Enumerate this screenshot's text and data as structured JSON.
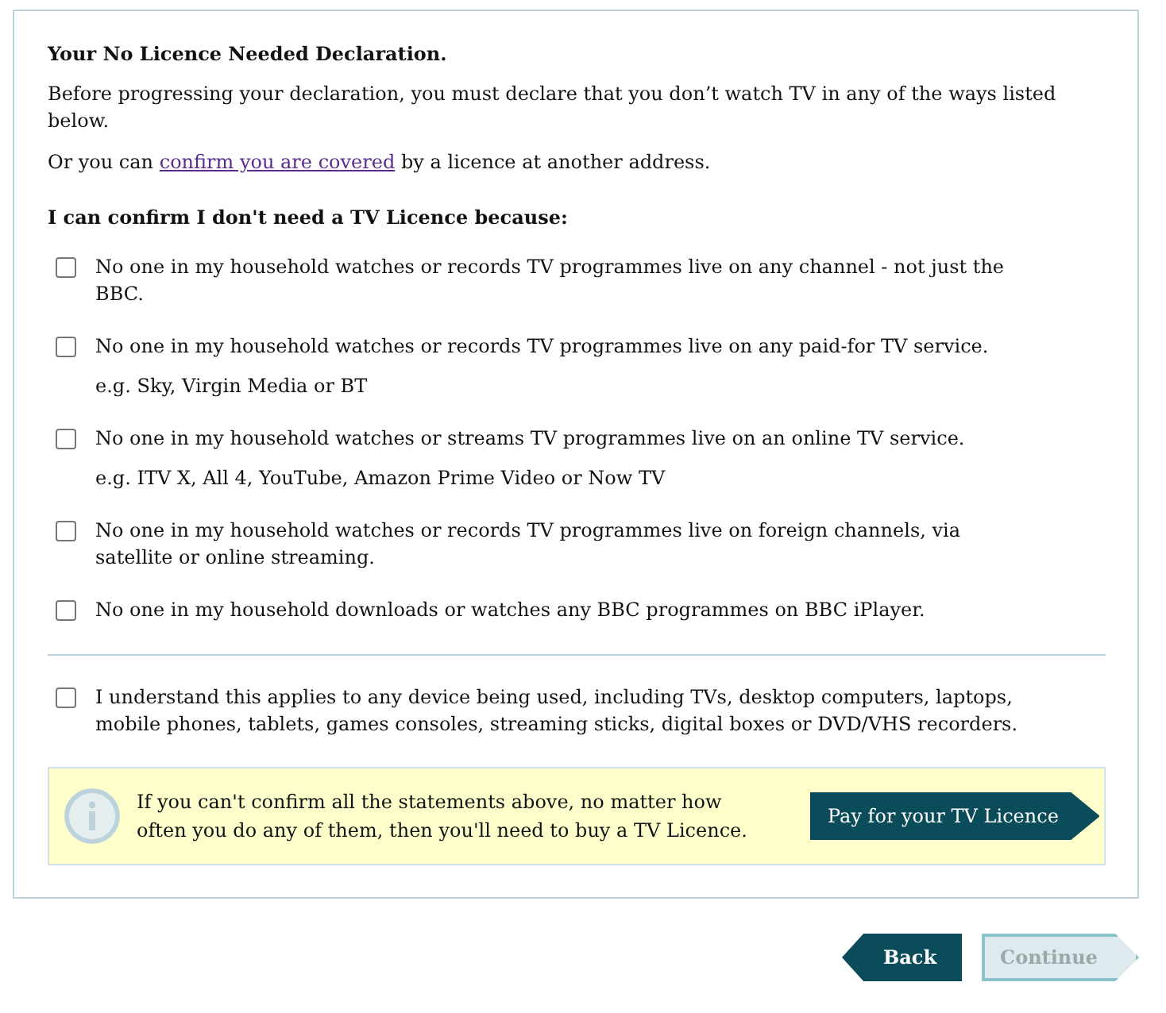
{
  "heading": "Your No Licence Needed Declaration.",
  "intro": "Before progressing your declaration, you must declare that you don’t watch TV in any of the ways listed below.",
  "covered": {
    "before": "Or you can",
    "link": "confirm you are covered",
    "after": "by a licence at another address."
  },
  "question": "I can confirm I don't need a TV Licence because:",
  "statements": [
    {
      "label": "No one in my household watches or records TV programmes live on any channel - not just the BBC.",
      "checked": false
    },
    {
      "label": "No one in my household watches or records TV programmes live on any paid-for TV service.",
      "hint": "e.g. Sky, Virgin Media or BT",
      "checked": false
    },
    {
      "label": "No one in my household watches or streams TV programmes live on an online TV service.",
      "hint": "e.g. ITV X, All 4, YouTube, Amazon Prime Video or Now TV",
      "checked": false
    },
    {
      "label": "No one in my household watches or records TV programmes live on foreign channels, via satellite or online streaming.",
      "checked": false
    },
    {
      "label": "No one in my household downloads or watches any BBC programmes on BBC iPlayer.",
      "checked": false
    }
  ],
  "understand": {
    "label": "I understand this applies to any device being used, including TVs, desktop computers, laptops, mobile phones, tablets, games consoles, streaming sticks, digital boxes or DVD/VHS recorders.",
    "checked": false
  },
  "notice": {
    "text": "If you can't confirm all the statements above, no matter how often you do any of them, then you'll need to buy a TV Licence.",
    "button": "Pay for your TV Licence"
  },
  "nav": [
    {
      "label": "Back",
      "kind": "back",
      "disabled": false
    },
    {
      "label": "Continue",
      "kind": "next",
      "disabled": true
    }
  ]
}
